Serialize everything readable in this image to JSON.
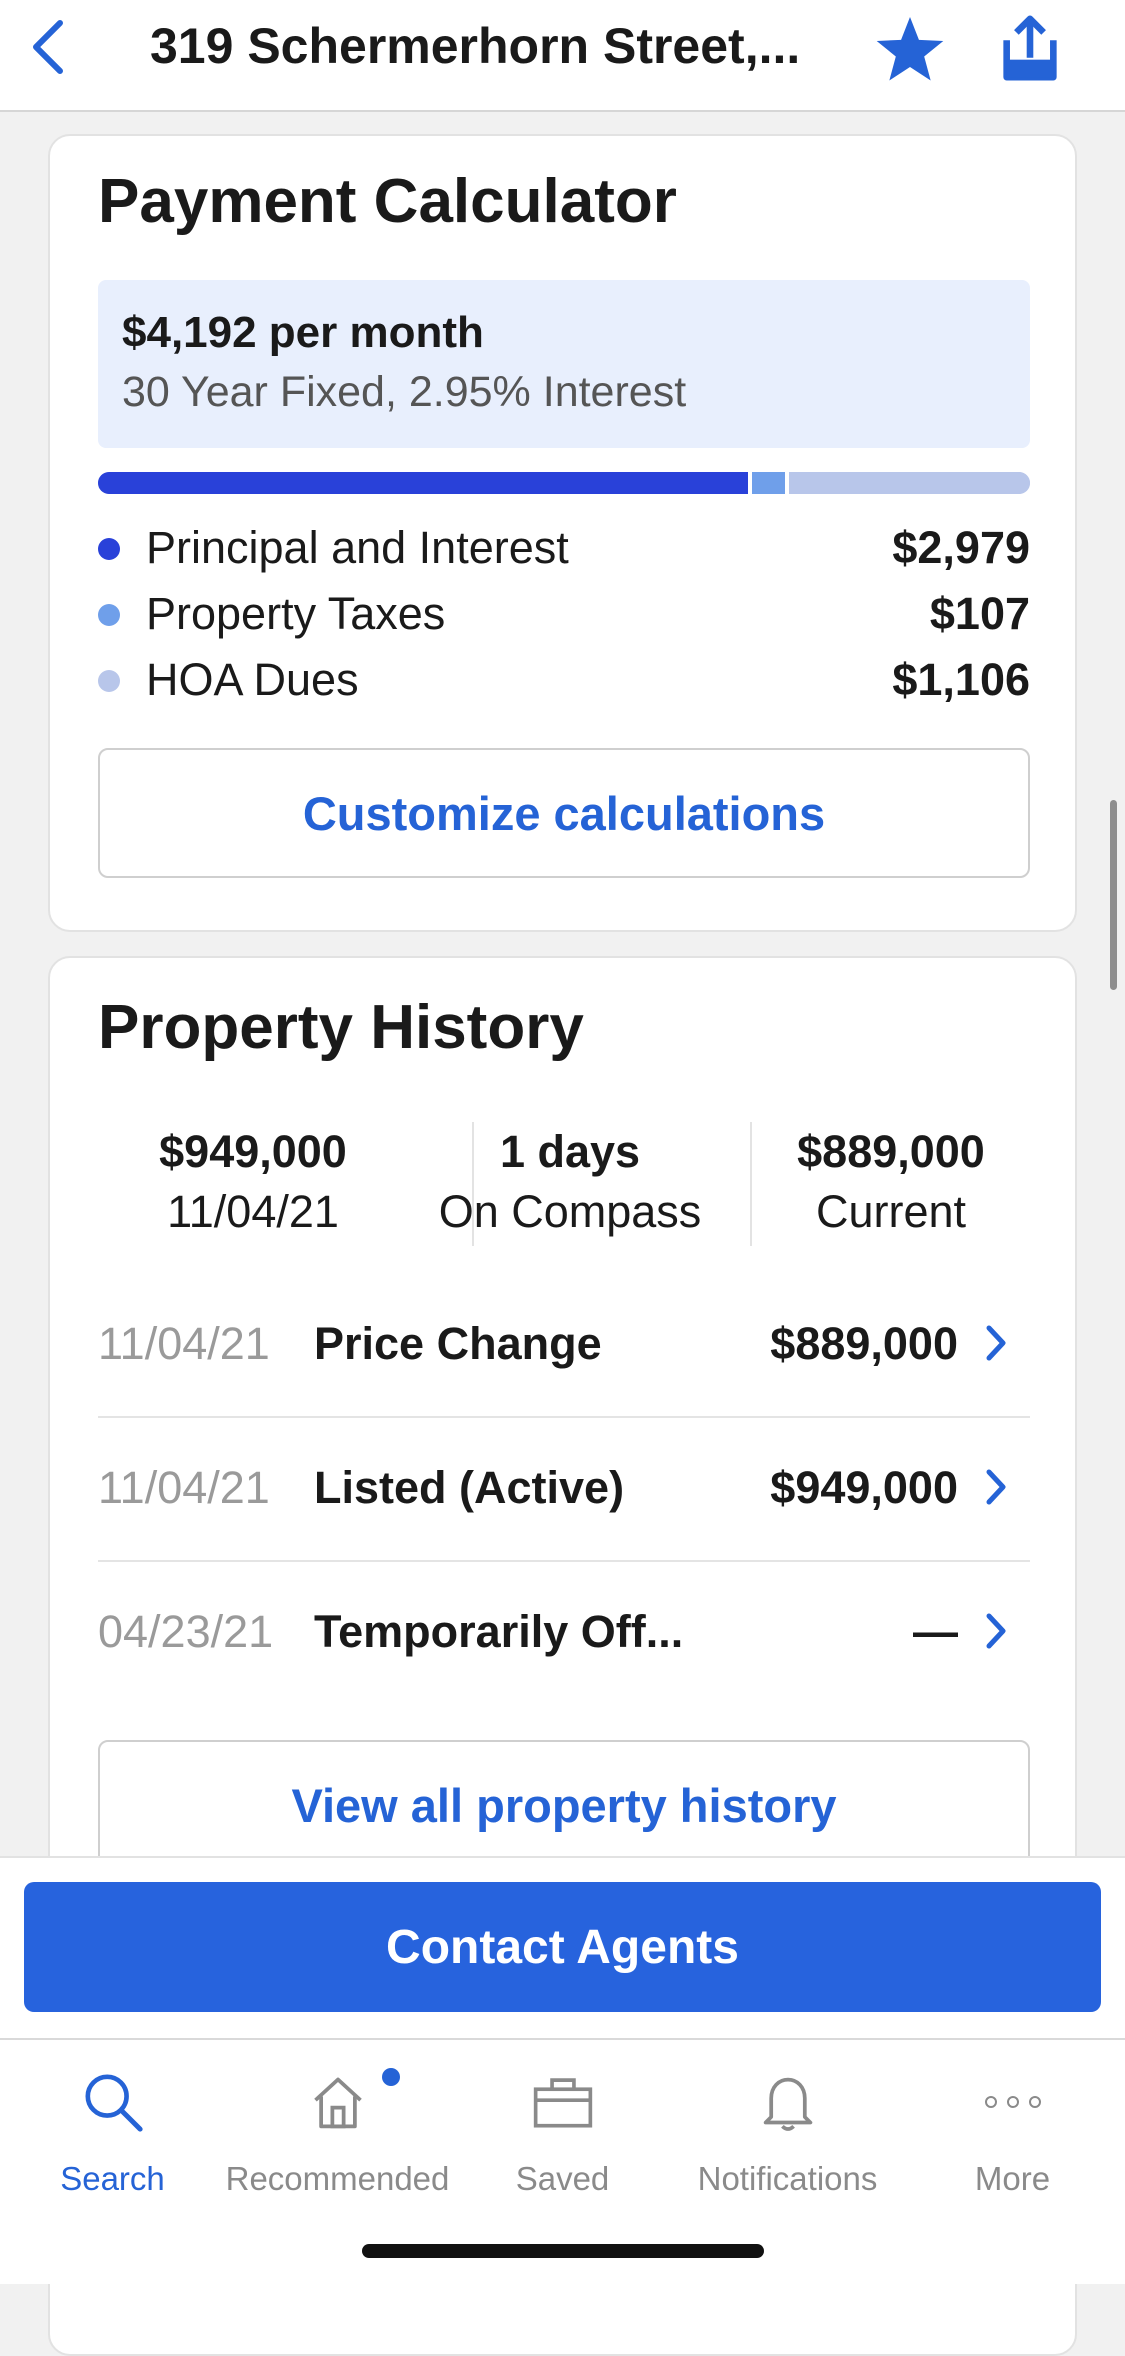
{
  "header": {
    "title": "319 Schermerhorn Street,...",
    "accent_color": "#2563d6",
    "icons": [
      "chevron-left-icon",
      "star-icon",
      "share-icon"
    ]
  },
  "payment": {
    "title": "Payment Calculator",
    "monthly": "$4,192 per month",
    "terms": "30 Year Fixed, 2.95% Interest",
    "breakdown": [
      {
        "label": "Principal and Interest",
        "value": "$2,979",
        "amount": 2979,
        "color": "#2941d9"
      },
      {
        "label": "Property Taxes",
        "value": "$107",
        "amount": 107,
        "color": "#6f9fea"
      },
      {
        "label": "HOA Dues",
        "value": "$1,106",
        "amount": 1106,
        "color": "#b8c6ea"
      }
    ],
    "customize_label": "Customize calculations"
  },
  "history": {
    "title": "Property History",
    "stats": [
      {
        "line1": "$949,000",
        "line2": "11/04/21"
      },
      {
        "line1": "1 days",
        "line2": "On Compass"
      },
      {
        "line1": "$889,000",
        "line2": "Current"
      }
    ],
    "rows": [
      {
        "date": "11/04/21",
        "event": "Price Change",
        "price": "$889,000"
      },
      {
        "date": "11/04/21",
        "event": "Listed (Active)",
        "price": "$949,000"
      },
      {
        "date": "04/23/21",
        "event": "Temporarily Off...",
        "price": "—"
      }
    ],
    "view_all_label": "View all property history"
  },
  "contact": {
    "label": "Contact Agents",
    "color": "#2763dd"
  },
  "tabs": [
    {
      "label": "Search",
      "icon": "search-icon",
      "active": true
    },
    {
      "label": "Recommended",
      "icon": "home-icon",
      "active": false,
      "badge": true
    },
    {
      "label": "Saved",
      "icon": "briefcase-icon",
      "active": false
    },
    {
      "label": "Notifications",
      "icon": "bell-icon",
      "active": false
    },
    {
      "label": "More",
      "icon": "more-icon",
      "active": false
    }
  ]
}
